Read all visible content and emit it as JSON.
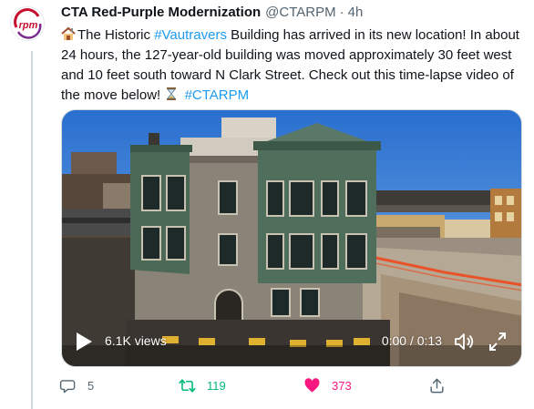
{
  "tweet": {
    "author": {
      "display_name": "CTA Red-Purple Modernization",
      "handle": "@CTARPM",
      "separator": "·",
      "time": "4h",
      "avatar_text": "rpm"
    },
    "text": {
      "before_tag": "The Historic ",
      "tag": "#Vautravers",
      "after_tag": " Building has arrived in its new location! In about 24 hours, the 127-year-old building was moved approximately 30 feet west and 10 feet south toward N Clark Street. Check out this time-lapse video of the move below! ",
      "hashtag": "#CTARPM",
      "emoji_start": "house-building-icon",
      "emoji_end": "hourglass-icon"
    },
    "video": {
      "views": "6.1K views",
      "timecode": "0:00 / 0:13"
    },
    "stats": {
      "replies": "5",
      "retweets": "119",
      "likes": "373"
    },
    "colors": {
      "link": "#1d9bf0",
      "retweet_active": "#00ba7c",
      "like_active": "#f91880",
      "avatar_brand": "#c8102e"
    }
  }
}
